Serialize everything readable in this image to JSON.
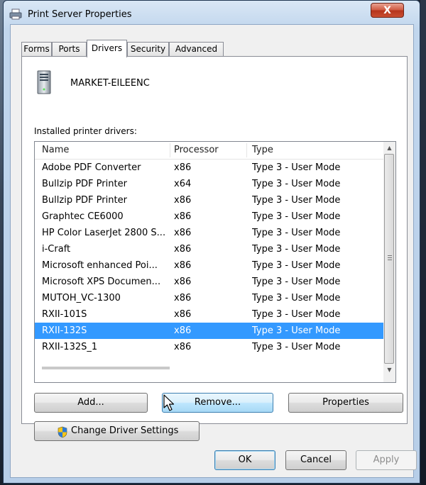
{
  "window": {
    "title": "Print Server Properties",
    "close_glyph": "X",
    "icon": "printer-icon"
  },
  "tabs": [
    "Forms",
    "Ports",
    "Drivers",
    "Security",
    "Advanced"
  ],
  "active_tab": "Drivers",
  "server": {
    "icon": "server-icon",
    "name": "MARKET-EILEENC"
  },
  "drivers": {
    "label": "Installed printer drivers:",
    "columns": [
      "Name",
      "Processor",
      "Type"
    ],
    "rows": [
      [
        "Adobe PDF Converter",
        "x86",
        "Type 3 - User Mode"
      ],
      [
        "Bullzip PDF Printer",
        "x64",
        "Type 3 - User Mode"
      ],
      [
        "Bullzip PDF Printer",
        "x86",
        "Type 3 - User Mode"
      ],
      [
        "Graphtec CE6000",
        "x86",
        "Type 3 - User Mode"
      ],
      [
        "HP Color LaserJet 2800 S...",
        "x86",
        "Type 3 - User Mode"
      ],
      [
        "i-Craft",
        "x86",
        "Type 3 - User Mode"
      ],
      [
        "Microsoft enhanced Poi...",
        "x86",
        "Type 3 - User Mode"
      ],
      [
        "Microsoft XPS Documen...",
        "x86",
        "Type 3 - User Mode"
      ],
      [
        "MUTOH_VC-1300",
        "x86",
        "Type 3 - User Mode"
      ],
      [
        "RXII-101S",
        "x86",
        "Type 3 - User Mode"
      ],
      [
        "RXII-132S",
        "x86",
        "Type 3 - User Mode"
      ],
      [
        "RXII-132S_1",
        "x86",
        "Type 3 - User Mode"
      ]
    ],
    "selected_row": "RXII-132S"
  },
  "buttons": {
    "add": "Add...",
    "remove": "Remove...",
    "properties": "Properties",
    "change_driver_settings": "Change Driver Settings",
    "ok": "OK",
    "cancel": "Cancel",
    "apply": "Apply"
  },
  "colors": {
    "selection": "#3399ff",
    "close_button": "#c94e31",
    "hover_button": "#bee6fd"
  }
}
